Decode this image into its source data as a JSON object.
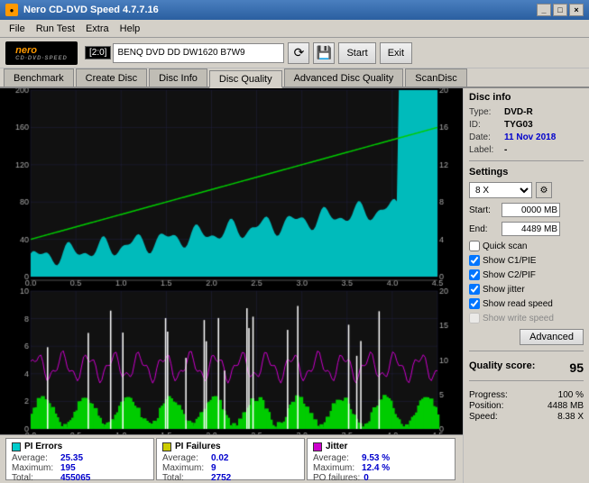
{
  "window": {
    "title": "Nero CD-DVD Speed 4.7.7.16",
    "controls": [
      "_",
      "□",
      "×"
    ]
  },
  "menu": {
    "items": [
      "File",
      "Run Test",
      "Extra",
      "Help"
    ]
  },
  "toolbar": {
    "logo_text": "nero",
    "logo_sub": "CD·DVD·SPEED",
    "drive_label": "[2:0]",
    "drive_value": "BENQ DVD DD DW1620 B7W9",
    "start_label": "Start",
    "exit_label": "Exit"
  },
  "tabs": [
    {
      "id": "benchmark",
      "label": "Benchmark"
    },
    {
      "id": "create-disc",
      "label": "Create Disc"
    },
    {
      "id": "disc-info",
      "label": "Disc Info"
    },
    {
      "id": "disc-quality",
      "label": "Disc Quality",
      "active": true
    },
    {
      "id": "advanced-disc-quality",
      "label": "Advanced Disc Quality"
    },
    {
      "id": "scandisc",
      "label": "ScanDisc"
    }
  ],
  "disc_info": {
    "section_title": "Disc info",
    "type_label": "Type:",
    "type_value": "DVD-R",
    "id_label": "ID:",
    "id_value": "TYG03",
    "date_label": "Date:",
    "date_value": "11 Nov 2018",
    "label_label": "Label:",
    "label_value": "-"
  },
  "settings": {
    "section_title": "Settings",
    "speed_value": "8 X",
    "start_label": "Start:",
    "start_value": "0000 MB",
    "end_label": "End:",
    "end_value": "4489 MB",
    "quick_scan_label": "Quick scan",
    "quick_scan_checked": false,
    "show_c1pie_label": "Show C1/PIE",
    "show_c1pie_checked": true,
    "show_c2pif_label": "Show C2/PIF",
    "show_c2pif_checked": true,
    "show_jitter_label": "Show jitter",
    "show_jitter_checked": true,
    "show_read_speed_label": "Show read speed",
    "show_read_speed_checked": true,
    "show_write_speed_label": "Show write speed",
    "show_write_speed_checked": false,
    "advanced_label": "Advanced"
  },
  "quality_score": {
    "label": "Quality score:",
    "value": "95"
  },
  "progress": {
    "progress_label": "Progress:",
    "progress_value": "100 %",
    "position_label": "Position:",
    "position_value": "4488 MB",
    "speed_label": "Speed:",
    "speed_value": "8.38 X"
  },
  "stats": {
    "pi_errors": {
      "title": "PI Errors",
      "color": "#00cccc",
      "avg_label": "Average:",
      "avg_value": "25.35",
      "max_label": "Maximum:",
      "max_value": "195",
      "total_label": "Total:",
      "total_value": "455065"
    },
    "pi_failures": {
      "title": "PI Failures",
      "color": "#cccc00",
      "avg_label": "Average:",
      "avg_value": "0.02",
      "max_label": "Maximum:",
      "max_value": "9",
      "total_label": "Total:",
      "total_value": "2752"
    },
    "jitter": {
      "title": "Jitter",
      "color": "#cc00cc",
      "avg_label": "Average:",
      "avg_value": "9.53 %",
      "max_label": "Maximum:",
      "max_value": "12.4 %",
      "po_label": "PO failures:",
      "po_value": "0"
    }
  },
  "chart": {
    "top_ymax": "200",
    "top_ymid": "160",
    "top_y80": "80",
    "top_y40": "40",
    "top_y0": "0",
    "top_right_20": "20",
    "top_right_16": "16",
    "top_right_12": "12",
    "top_right_8": "8",
    "top_right_4": "4",
    "x_labels": [
      "0.0",
      "0.5",
      "1.0",
      "1.5",
      "2.0",
      "2.5",
      "3.0",
      "3.5",
      "4.0",
      "4.5"
    ],
    "bottom_y10": "10",
    "bottom_y8": "8",
    "bottom_y6": "6",
    "bottom_y4": "4",
    "bottom_y2": "2",
    "bottom_y0": "0",
    "bottom_right_20": "20",
    "bottom_right_15": "15",
    "bottom_right_10": "10",
    "bottom_right_5": "5"
  }
}
